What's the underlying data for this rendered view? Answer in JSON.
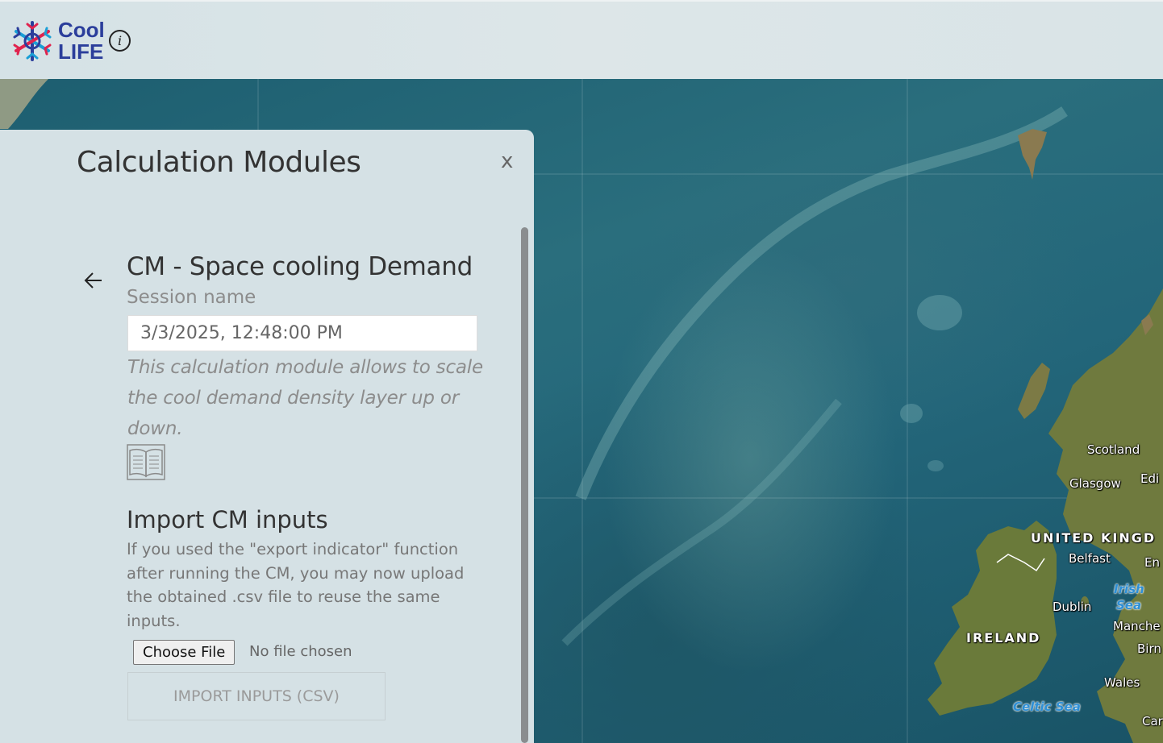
{
  "header": {
    "logo_line1": "Cool",
    "logo_line2": "LIFE",
    "info_icon": "i"
  },
  "panel": {
    "title": "Calculation Modules",
    "close_label": "x",
    "module": {
      "title": "CM - Space cooling Demand",
      "session_label": "Session name",
      "session_value": "3/3/2025, 12:48:00 PM",
      "description": "This calculation module allows to scale the cool demand density layer up or down.",
      "doc_icon": "book-icon"
    },
    "import": {
      "title": "Import CM inputs",
      "description": "If you used the \"export indicator\" function after running the CM, you may now upload the obtained .csv file to reuse the same inputs.",
      "choose_file_label": "Choose File",
      "no_file_text": "No file chosen",
      "import_button": "IMPORT INPUTS (CSV)"
    }
  },
  "map": {
    "labels": {
      "scotland": "Scotland",
      "glasgow": "Glasgow",
      "edinburgh": "Edi",
      "uk": "UNITED KINGD",
      "belfast": "Belfast",
      "england": "En",
      "irish_sea_1": "Irish",
      "irish_sea_2": "Sea",
      "dublin": "Dublin",
      "manchester": "Manche",
      "ireland": "IRELAND",
      "birmingham": "Birn",
      "wales": "Wales",
      "celtic_sea": "Celtic Sea",
      "cardiff": "Car"
    }
  },
  "colors": {
    "logo_blue": "#2b3e9b",
    "logo_red": "#e0234e",
    "logo_cyan": "#1a9fd6",
    "panel_bg": "#d5e1e5",
    "ocean": "#1d5e70",
    "land": "#6f7a3e"
  }
}
